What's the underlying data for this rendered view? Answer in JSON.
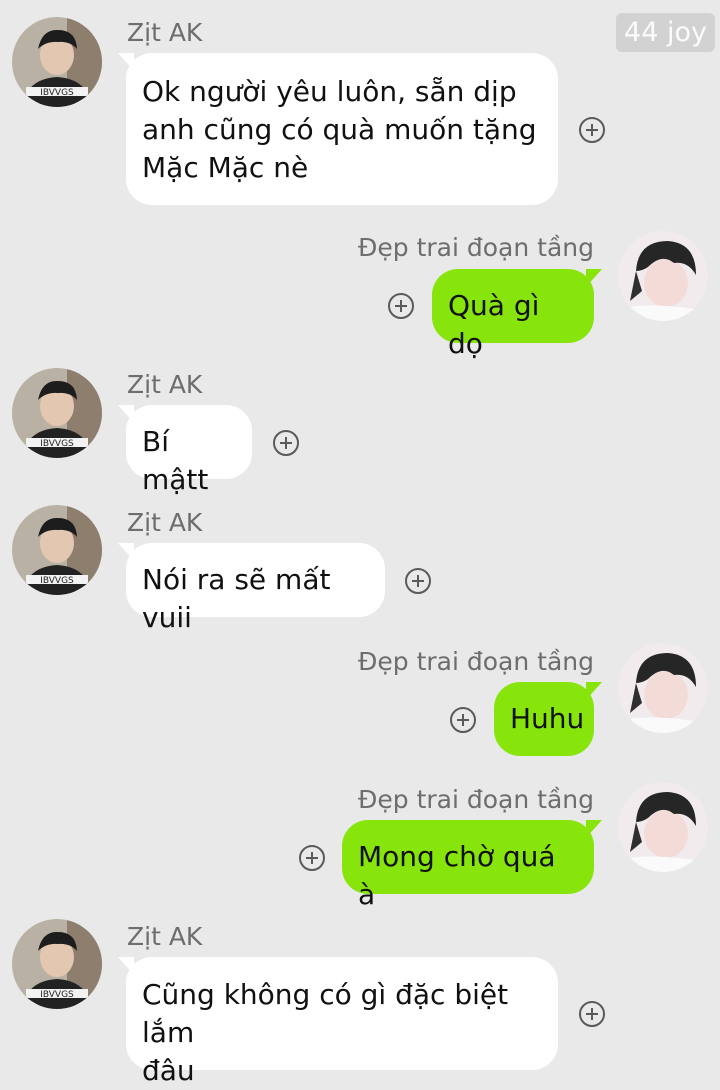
{
  "watermark": "44 joy",
  "contacts": {
    "a": {
      "name": "Zịt AK"
    },
    "b": {
      "name": "Đẹp trai đoạn tầng"
    }
  },
  "messages": [
    {
      "sender": "Zịt AK",
      "text": "Ok người yêu luôn, sẵn dịp\nanh cũng có quà muốn tặng\nMặc Mặc nè"
    },
    {
      "sender": "Đẹp trai đoạn tầng",
      "text": "Quà gì dọ"
    },
    {
      "sender": "Zịt AK",
      "text": "Bí mậtt"
    },
    {
      "sender": "Zịt AK",
      "text": "Nói ra sẽ mất vuii"
    },
    {
      "sender": "Đẹp trai đoạn tầng",
      "text": "Huhu"
    },
    {
      "sender": "Đẹp trai đoạn tầng",
      "text": "Mong chờ quá à"
    },
    {
      "sender": "Zịt AK",
      "text": "Cũng không có gì đặc biệt lắm\nđâu"
    }
  ],
  "icons": {
    "react": "add-reaction-icon"
  },
  "colors": {
    "background": "#e9e9e9",
    "incoming_bubble": "#ffffff",
    "outgoing_bubble": "#87e50c"
  }
}
